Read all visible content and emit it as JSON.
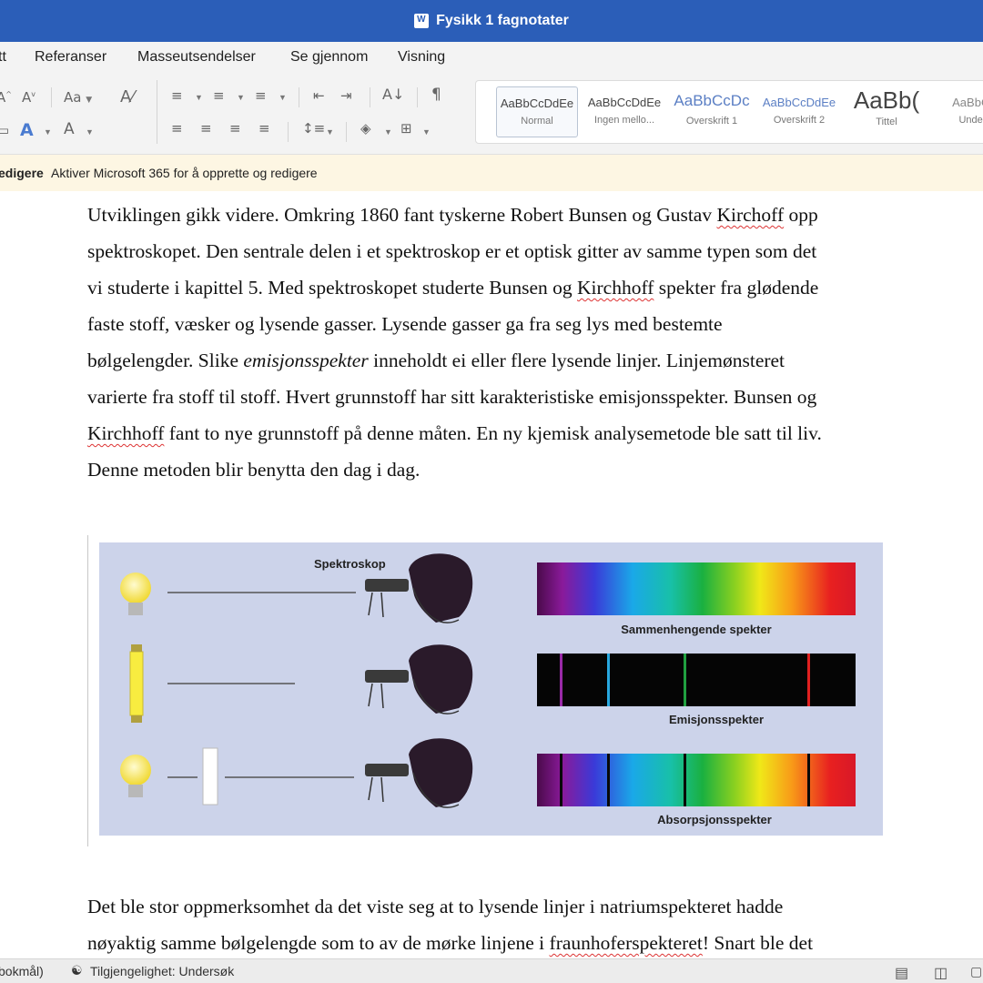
{
  "window": {
    "title": "Fysikk 1 fagnotater"
  },
  "menu": {
    "items": [
      "tt",
      "Referanser",
      "Masseutsendelser",
      "Se gjennom",
      "Visning"
    ]
  },
  "ribbon": {
    "font_case_label": "Aa",
    "styles": [
      {
        "sample": "AaBbCcDdEe",
        "name": "Normal"
      },
      {
        "sample": "AaBbCcDdEe",
        "name": "Ingen mello..."
      },
      {
        "sample": "AaBbCcDc",
        "name": "Overskrift 1"
      },
      {
        "sample": "AaBbCcDdEe",
        "name": "Overskrift 2"
      },
      {
        "sample": "AaBb(",
        "name": "Tittel"
      },
      {
        "sample": "AaBbCc",
        "name": "Undert"
      }
    ]
  },
  "banner": {
    "left": "edigere",
    "message": "Aktiver Microsoft 365 for å opprette og redigere"
  },
  "paragraph1": {
    "l1a": "Utviklingen gikk videre. Omkring 1860 fant tyskerne Robert Bunsen og Gustav ",
    "l1b": "Kirchoff",
    "l1c": " opp",
    "l2": "spektroskopet. Den sentrale delen i et spektroskop er et optisk gitter av samme typen som det",
    "l3a": "vi studerte i kapittel 5. Med spektroskopet studerte Bunsen og ",
    "l3b": "Kirchhoff",
    "l3c": " spekter fra glødende",
    "l4": "faste stoff, væsker og lysende gasser. Lysende gasser ga fra seg lys med bestemte",
    "l5a": "bølgelengder. Slike ",
    "l5b": "emisjonsspekter",
    "l5c": " inneholdt ei eller flere lysende linjer. Linjemønsteret",
    "l6": "varierte fra stoff til stoff. Hvert grunnstoff har sitt karakteristiske emisjonsspekter. Bunsen og",
    "l7a": "Kirchhoff",
    "l7b": " fant to nye grunnstoff på denne måten. En ny kjemisk analysemetode ble satt til liv.",
    "l8": "Denne metoden blir benytta den dag i dag."
  },
  "figure": {
    "spectroscope_label": "Spektroskop",
    "continuous_label": "Sammenhengende spekter",
    "emission_label": "Emisjonsspekter",
    "absorption_label": "Absorpsjonsspekter"
  },
  "paragraph2": {
    "l1": "Det ble stor oppmerksomhet da det viste seg at to lysende linjer i natriumspekteret hadde",
    "l2a": "nøyaktig samme bølgelengde som to av de mørke linjene i ",
    "l2b": "fraunhoferspekteret",
    "l2c": "! Snart ble det"
  },
  "status": {
    "language": "bokmål)",
    "accessibility": "Tilgjengelighet: Undersøk"
  }
}
